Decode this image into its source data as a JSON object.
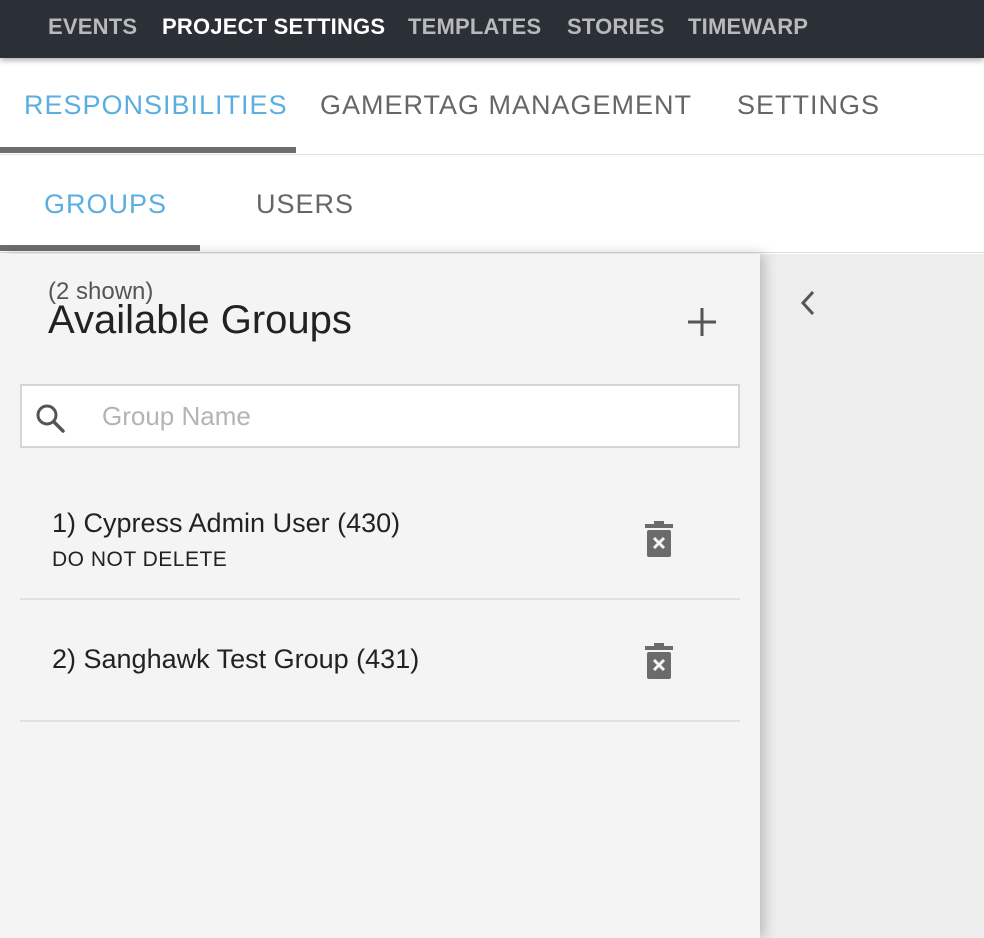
{
  "top_nav": {
    "items": [
      {
        "label": "EVENTS"
      },
      {
        "label": "PROJECT SETTINGS"
      },
      {
        "label": "TEMPLATES"
      },
      {
        "label": "STORIES"
      },
      {
        "label": "TIMEWARP"
      }
    ],
    "active": "PROJECT SETTINGS"
  },
  "primary_tabs": {
    "items": [
      {
        "label": "RESPONSIBILITIES"
      },
      {
        "label": "GAMERTAG MANAGEMENT"
      },
      {
        "label": "SETTINGS"
      }
    ],
    "active": "RESPONSIBILITIES"
  },
  "secondary_tabs": {
    "items": [
      {
        "label": "GROUPS"
      },
      {
        "label": "USERS"
      }
    ],
    "active": "GROUPS"
  },
  "panel": {
    "count_label": "(2 shown)",
    "title": "Available Groups",
    "search_placeholder": "Group Name",
    "search_value": "",
    "groups": [
      {
        "name": "1) Cypress Admin User (430)",
        "description": "DO NOT DELETE"
      },
      {
        "name": "2) Sanghawk Test Group (431)",
        "description": ""
      }
    ]
  },
  "icons": {
    "add": "plus-icon",
    "search": "search-icon",
    "delete": "trash-x-icon",
    "collapse": "chevron-left-icon"
  },
  "colors": {
    "nav_bg": "#2b2f36",
    "accent": "#5aaee0",
    "tab_text": "#666666",
    "panel_bg": "#f4f4f4",
    "icon": "#6b6b6b"
  }
}
